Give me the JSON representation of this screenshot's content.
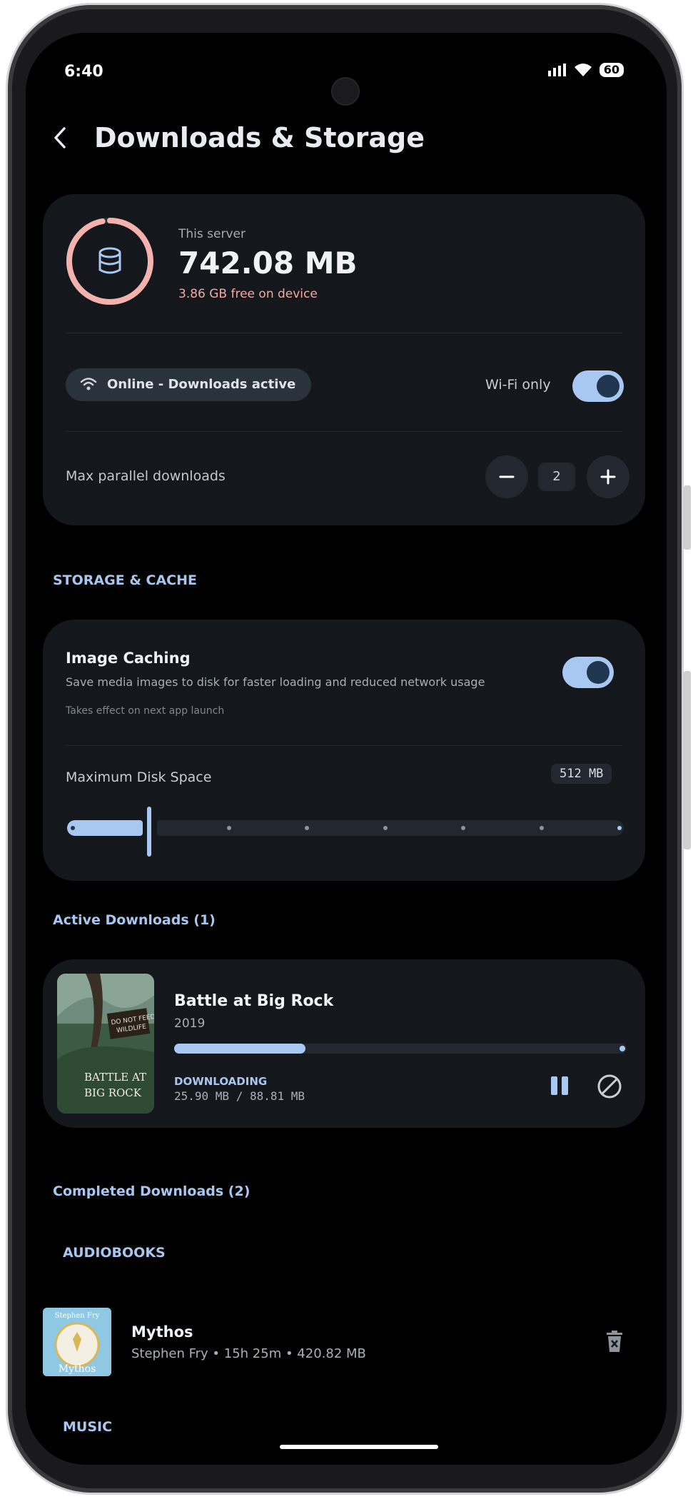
{
  "status": {
    "time": "6:40",
    "battery": "60"
  },
  "header": {
    "title": "Downloads & Storage"
  },
  "server": {
    "label": "This server",
    "size": "742.08 MB",
    "free": "3.86 GB free on device",
    "usage_fraction": 0.97,
    "online_label": "Online - Downloads active",
    "wifi_only_label": "Wi-Fi only",
    "wifi_only_enabled": true,
    "parallel_label": "Max parallel downloads",
    "parallel_count": "2"
  },
  "storage": {
    "section_title": "STORAGE & CACHE",
    "image_caching": {
      "title": "Image Caching",
      "description": "Save media images to disk for faster loading and reduced network usage",
      "note": "Takes effect on next app launch",
      "enabled": true
    },
    "max_disk": {
      "label": "Maximum Disk Space",
      "value": "512 MB",
      "step_index": 1,
      "step_count": 8
    }
  },
  "active": {
    "section_title": "Active Downloads (1)",
    "items": [
      {
        "title": "Battle at Big Rock",
        "year": "2019",
        "status": "DOWNLOADING",
        "bytes": "25.90 MB / 88.81 MB",
        "progress": 0.29,
        "cover_text_1": "DO NOT FEED",
        "cover_text_2": "WILDLIFE",
        "cover_title_1": "BATTLE AT",
        "cover_title_2": "BIG ROCK"
      }
    ]
  },
  "completed": {
    "section_title": "Completed Downloads (2)",
    "audiobooks_label": "AUDIOBOOKS",
    "music_label": "MUSIC",
    "items": [
      {
        "title": "Mythos",
        "meta": "Stephen Fry • 15h 25m • 420.82 MB",
        "cover_author": "Stephen Fry",
        "cover_title": "Mythos"
      }
    ]
  },
  "colors": {
    "accent": "#a9c8f1",
    "danger_ring": "#f3b2ad",
    "card": "#14171b",
    "background": "#000000"
  },
  "icons": {
    "back": "back-arrow-icon",
    "storage": "database-icon",
    "wifi": "wifi-icon",
    "pause": "pause-icon",
    "cancel": "cancel-icon",
    "delete": "trash-icon"
  }
}
